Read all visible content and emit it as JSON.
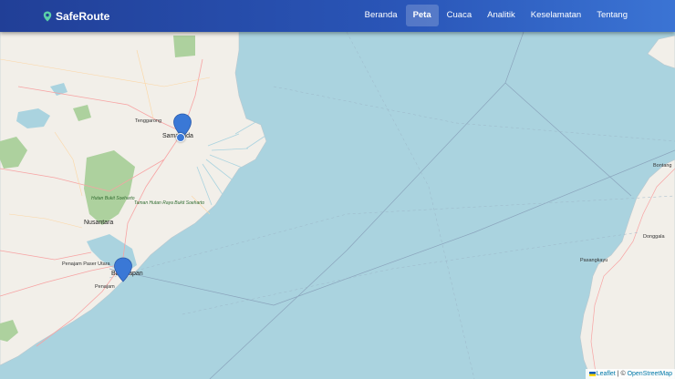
{
  "brand": {
    "name": "SafeRoute",
    "icon": "map-pin-icon"
  },
  "nav": {
    "items": [
      {
        "label": "Beranda",
        "active": false
      },
      {
        "label": "Peta",
        "active": true
      },
      {
        "label": "Cuaca",
        "active": false
      },
      {
        "label": "Analitik",
        "active": false
      },
      {
        "label": "Keselamatan",
        "active": false
      },
      {
        "label": "Tentang",
        "active": false
      }
    ]
  },
  "map": {
    "labels": {
      "tenggarong": "Tenggarong",
      "samarinda": "Samarinda",
      "hutan_bukit_soeharto": "Hutan Bukit Soeharto",
      "taman_hutan_raya": "Taman Hutan Raya Bukit Soeharto",
      "nusantara": "Nusantara",
      "balikpapan": "Balikpapan",
      "penajam_paser_utara": "Penajam Paser Utara",
      "penajam": "Penajam",
      "bontang": "Bontang",
      "donggala": "Donggala",
      "pasangkayu": "Pasangkayu"
    },
    "colors": {
      "sea": "#aad3df",
      "land": "#f2efe9",
      "forest": "#add19e",
      "route": "#3a78d6"
    }
  },
  "attribution": {
    "leaflet": "Leaflet",
    "separator": " | © ",
    "osm": "OpenStreetMap"
  }
}
